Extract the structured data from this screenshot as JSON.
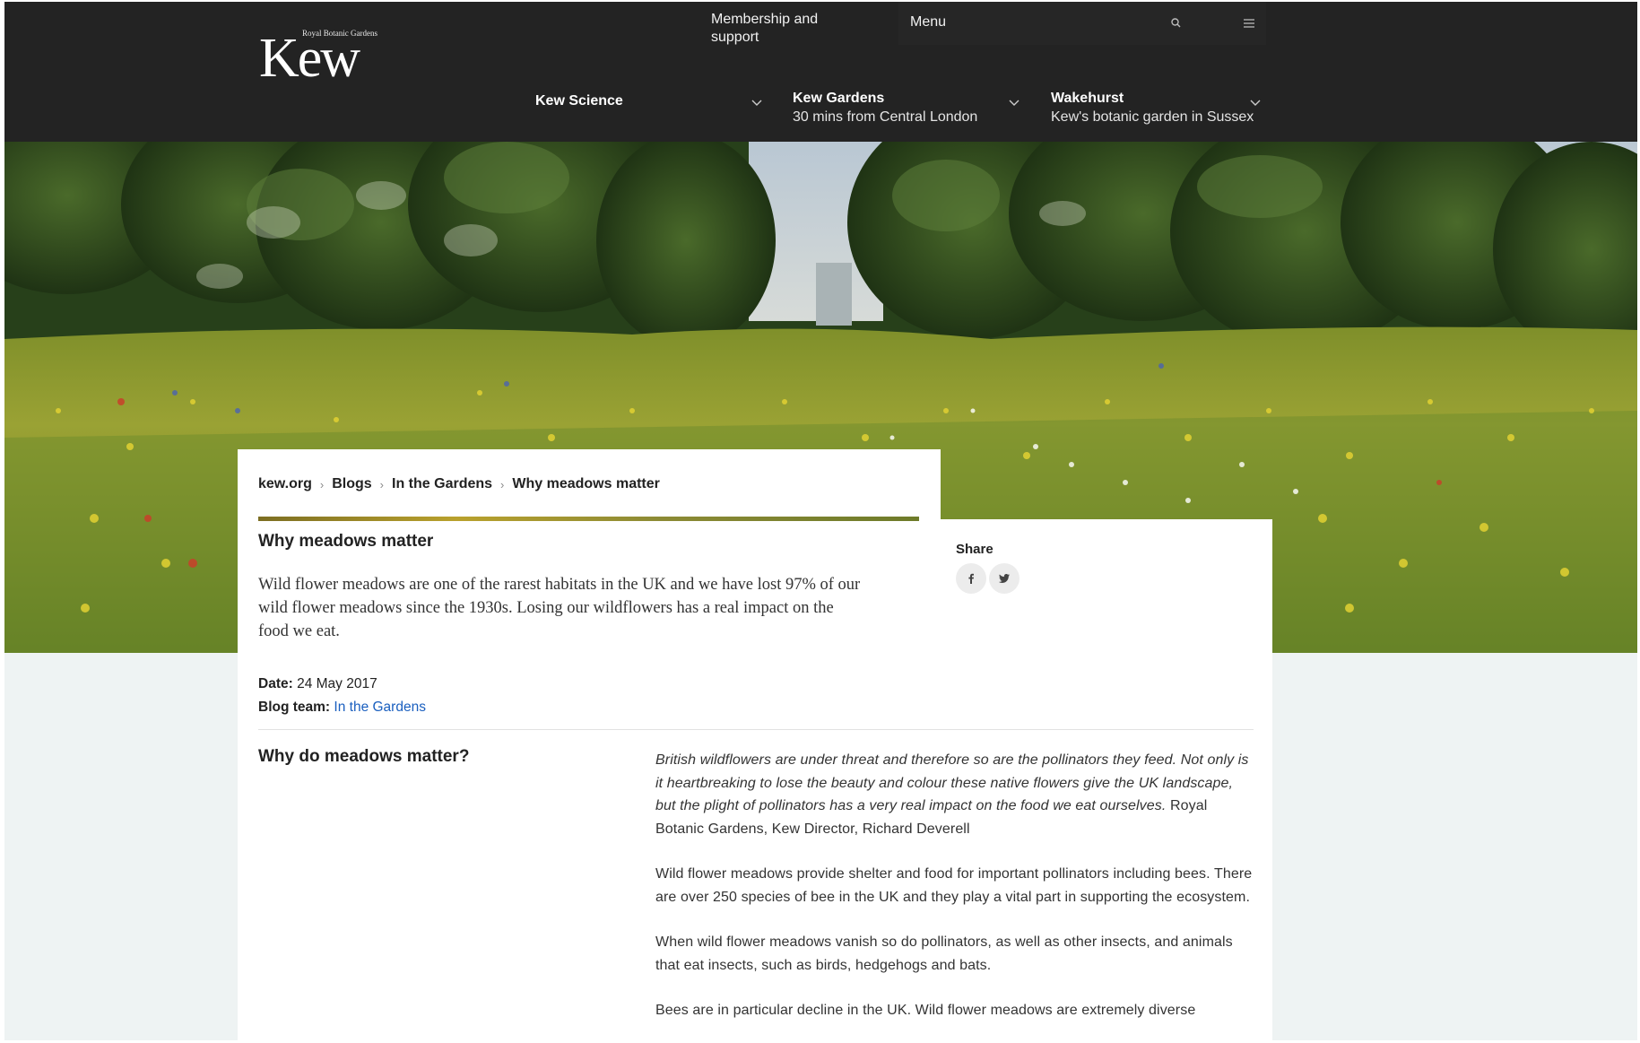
{
  "header": {
    "logo_small": "Royal Botanic Gardens",
    "logo_text": "Kew",
    "membership_link": "Membership and support",
    "menu_label": "Menu",
    "nav": [
      {
        "title": "Kew Science",
        "subtitle": ""
      },
      {
        "title": "Kew Gardens",
        "subtitle": "30 mins from Central London"
      },
      {
        "title": "Wakehurst",
        "subtitle": "Kew's botanic garden in Sussex"
      }
    ]
  },
  "breadcrumb": {
    "items": [
      "kew.org",
      "Blogs",
      "In the Gardens",
      "Why meadows matter"
    ]
  },
  "article": {
    "title": "Why meadows matter",
    "intro": "Wild flower meadows are one of the rarest habitats in the UK and we have lost 97% of our wild flower meadows since the 1930s. Losing our wildflowers has a real impact on the food we eat.",
    "date_label": "Date:",
    "date_value": "24 May 2017",
    "team_label": "Blog team:",
    "team_value": "In the Gardens",
    "section_heading": "Why do meadows matter?",
    "quote": "British wildflowers are under threat and therefore so are the pollinators they feed. Not only is it heartbreaking to lose the beauty and colour these native flowers give the UK landscape, but the plight of pollinators has a very real impact on the food we eat ourselves.",
    "quote_attribution": " Royal Botanic Gardens, Kew Director, Richard Deverell",
    "paragraphs": [
      "Wild flower meadows provide shelter and food for important pollinators including bees. There are over 250 species of bee in the UK and they play a vital part in supporting the ecosystem.",
      "When wild flower meadows vanish so do pollinators, as well as other insects, and animals that eat insects, such as birds, hedgehogs and bats.",
      "Bees are in particular decline in the UK. Wild flower meadows are extremely diverse"
    ]
  },
  "share": {
    "label": "Share",
    "buttons": [
      "facebook-icon",
      "twitter-icon"
    ]
  },
  "colors": {
    "header_bg": "#232323",
    "page_bg": "#eef3f3",
    "link": "#1a5fbf"
  }
}
